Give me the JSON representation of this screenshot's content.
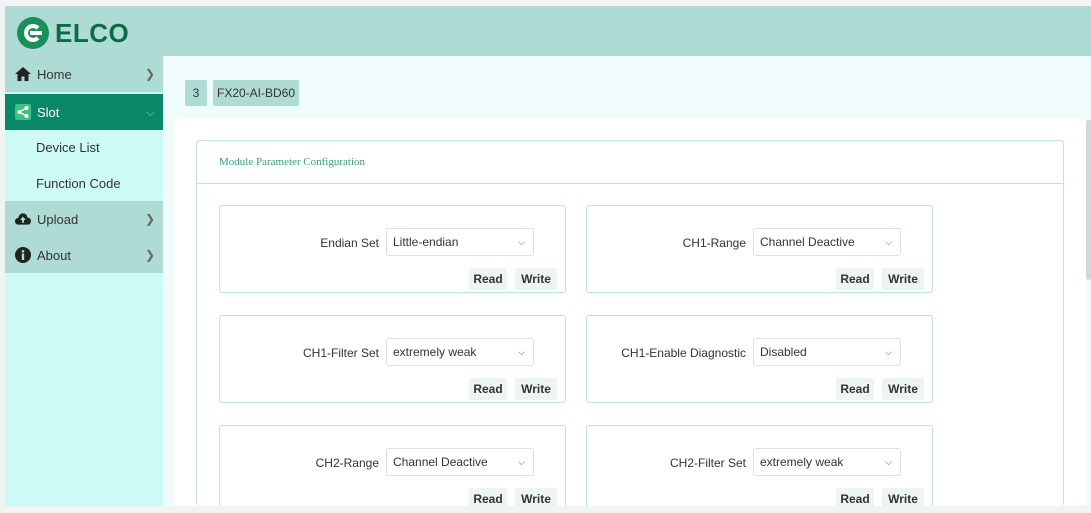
{
  "brand": {
    "name": "ELCO"
  },
  "sidebar": {
    "items": [
      {
        "label": "Home",
        "icon": "home-icon"
      },
      {
        "label": "Slot",
        "icon": "share-icon",
        "active": true
      },
      {
        "label": "Upload",
        "icon": "cloud-upload-icon"
      },
      {
        "label": "About",
        "icon": "info-icon"
      }
    ],
    "sub_items": [
      {
        "label": "Device List"
      },
      {
        "label": "Function Code"
      }
    ]
  },
  "tabs": {
    "slot_number": "3",
    "module_name": "FX20-AI-BD60"
  },
  "panel": {
    "title": "Module Parameter Configuration"
  },
  "buttons": {
    "read": "Read",
    "write": "Write"
  },
  "params": [
    {
      "label": "Endian Set",
      "value": "Little-endian"
    },
    {
      "label": "CH1-Range",
      "value": "Channel Deactive"
    },
    {
      "label": "CH1-Filter Set",
      "value": "extremely weak"
    },
    {
      "label": "CH1-Enable Diagnostic",
      "value": "Disabled"
    },
    {
      "label": "CH2-Range",
      "value": "Channel Deactive"
    },
    {
      "label": "CH2-Filter Set",
      "value": "extremely weak"
    }
  ],
  "colors": {
    "accent": "#0a8766",
    "header": "#aedcd5",
    "sidebar": "#cdf9f7",
    "brand": "#0d6b46"
  }
}
